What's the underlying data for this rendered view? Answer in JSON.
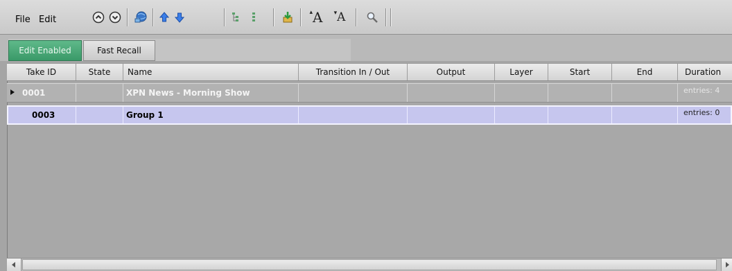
{
  "menu": {
    "file": "File",
    "edit": "Edit"
  },
  "toolbar": {
    "icons": [
      "circle-up-icon",
      "circle-down-icon",
      "globe-icon",
      "arrow-up-icon",
      "arrow-down-icon",
      "tree-expand-icon",
      "tree-collapse-icon",
      "import-icon",
      "font-increase-icon",
      "font-decrease-icon",
      "search-icon"
    ],
    "font_increase_glyph": "A",
    "font_decrease_glyph": "A"
  },
  "modes": {
    "edit_enabled": "Edit Enabled",
    "fast_recall": "Fast Recall",
    "active": "edit_enabled"
  },
  "columns": [
    "Take ID",
    "State",
    "Name",
    "Transition In / Out",
    "Output",
    "Layer",
    "Start",
    "End",
    "Duration"
  ],
  "rows": [
    {
      "take_id": "0001",
      "state": "",
      "name": "XPN News - Morning Show",
      "transition": "",
      "output": "",
      "layer": "",
      "start": "",
      "end": "",
      "duration": "entries: 4",
      "expandable": true,
      "selected": false
    },
    {
      "take_id": "0003",
      "state": "",
      "name": "Group 1",
      "transition": "",
      "output": "",
      "layer": "",
      "start": "",
      "end": "",
      "duration": "entries: 0",
      "expandable": false,
      "selected": true
    }
  ],
  "colors": {
    "edit_enabled": "#3a9968",
    "selected_row": "#c6c6ee",
    "background": "#a5a5a5"
  }
}
